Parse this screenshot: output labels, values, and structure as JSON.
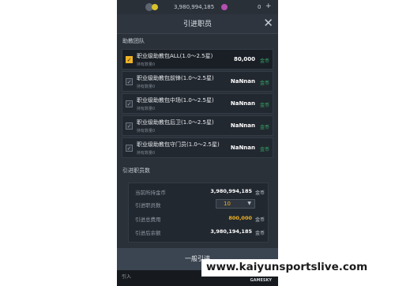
{
  "status_bar": {
    "currency_value": "3,980,994,185",
    "right_value": "0",
    "plus_label": "+"
  },
  "modal": {
    "title": "引进职员",
    "close_symbol": "✕",
    "section_team": "助教团队",
    "items": [
      {
        "name": "职业级助教包ALL(1.0～2.5星)",
        "sub": "持有数量0",
        "price": "80,000",
        "unit": "金币",
        "checked": true
      },
      {
        "name": "职业级助教包前锋(1.0～2.5星)",
        "sub": "持有数量0",
        "price": "NaNnan",
        "unit": "金币",
        "checked": false
      },
      {
        "name": "职业级助教包中场(1.0～2.5星)",
        "sub": "持有数量0",
        "price": "NaNnan",
        "unit": "金币",
        "checked": false
      },
      {
        "name": "职业级助教包后卫(1.0～2.5星)",
        "sub": "持有数量0",
        "price": "NaNnan",
        "unit": "金币",
        "checked": false
      },
      {
        "name": "职业级助教包守门员(1.0～2.5星)",
        "sub": "持有数量0",
        "price": "NaNnan",
        "unit": "金币",
        "checked": false
      }
    ],
    "section_count": "引进职员数",
    "summary": {
      "current_label": "当前所持金币",
      "current_value": "3,980,994,185",
      "current_unit": "金币",
      "count_label": "引进职员数",
      "count_value": "10",
      "total_label": "引进总费用",
      "total_value": "800,000",
      "total_unit": "金币",
      "remain_label": "引进后余额",
      "remain_value": "3,980,194,185",
      "remain_unit": "金币"
    }
  },
  "bottom_button": {
    "label": "一般引进"
  },
  "lower_bar": {
    "text": "引入",
    "brand": "GAMESKY"
  },
  "watermark": {
    "text": "www.kaiyunsportslive.com"
  },
  "colors": {
    "accent_gold": "#f0b323",
    "coin_green": "#37b26b",
    "bg_dark": "#1c2128"
  }
}
